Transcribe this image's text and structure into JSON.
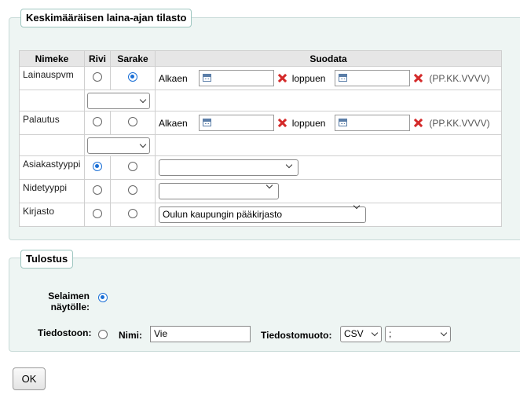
{
  "stats": {
    "legend": "Keskimääräisen laina-ajan tilasto",
    "headers": {
      "name": "Nimeke",
      "row": "Rivi",
      "column": "Sarake",
      "filter": "Suodata"
    },
    "rows": [
      {
        "name": "Lainauspvm",
        "row_checked": false,
        "col_checked": true,
        "from_label": "Alkaen",
        "to_label": "loppuen",
        "date_hint": "(PP.KK.VVVV)",
        "select_value": ""
      },
      {
        "name": "Palautus",
        "row_checked": false,
        "col_checked": false,
        "from_label": "Alkaen",
        "to_label": "loppuen",
        "date_hint": "(PP.KK.VVVV)",
        "select_value": ""
      },
      {
        "name": "Asiakastyyppi",
        "row_checked": true,
        "col_checked": false,
        "filter_value": ""
      },
      {
        "name": "Nidetyyppi",
        "row_checked": false,
        "col_checked": false,
        "filter_value": ""
      },
      {
        "name": "Kirjasto",
        "row_checked": false,
        "col_checked": false,
        "filter_value": "Oulun kaupungin pääkirjasto"
      }
    ]
  },
  "output": {
    "legend": "Tulostus",
    "browser_label": "Selaimen näytölle:",
    "browser_checked": true,
    "file_label": "Tiedostoon:",
    "file_checked": false,
    "name_label": "Nimi:",
    "name_value": "Vie",
    "format_label": "Tiedostomuoto:",
    "format_value": "CSV",
    "delimiter_value": ";"
  },
  "ok_button": "OK",
  "colors": {
    "accent": "#1a6fd6",
    "clear": "#d42a2a",
    "panel": "#eef5f3"
  }
}
